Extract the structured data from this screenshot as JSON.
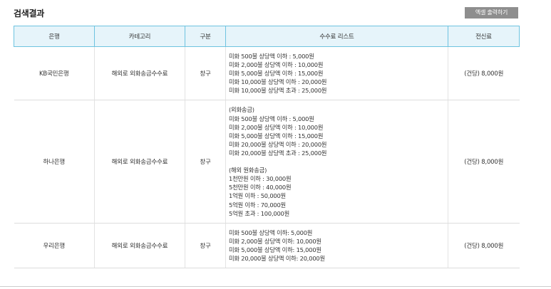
{
  "header": {
    "title": "검색결과",
    "export_label": "엑셀 출력하기"
  },
  "table": {
    "columns": [
      "은행",
      "카테고리",
      "구분",
      "수수료 리스트",
      "전신료"
    ],
    "rows": [
      {
        "bank": "KB국민은행",
        "category": "해외로 외화송금수수료",
        "type": "창구",
        "fees": [
          "미화 500불 상당액 이하 : 5,000원",
          "미화 2,000불 상당액 이하 : 10,000원",
          "미화 5,000불 상당액 이하 : 15,000원",
          "미화 10,000불 상당액 이하 : 20,000원",
          "미화 10,000불 상당액 초과 : 25,000원"
        ],
        "telegraph": "(건당) 8,000원"
      },
      {
        "bank": "하나은행",
        "category": "해외로 외화송금수수료",
        "type": "창구",
        "fees": [
          "(외화송금)",
          "미화 500불 상당액 이하 : 5,000원",
          "미화 2,000불 상당액 이하 : 10,000원",
          "미화 5,000불 상당액 이하 : 15,000원",
          "미화 20,000불 상당액 이하 : 20,000원",
          "미화 20,000불 상당액 초과 : 25,000원",
          "",
          "(해외 원화송금)",
          "1천만원 이하 : 30,000원",
          "5천만원 이하 : 40,000원",
          "1억원 이하 : 50,000원",
          "5억원 이하 : 70,000원",
          "5억원 초과 : 100,000원"
        ],
        "telegraph": "(건당) 8,000원"
      },
      {
        "bank": "우리은행",
        "category": "해외로 외화송금수수료",
        "type": "창구",
        "fees": [
          "미화 500불 상당액 이하: 5,000원",
          "미화 2,000불 상당액 이하: 10,000원",
          "미화 5,000불 상당액 이하: 15,000원",
          "미화 20,000불 상당액 이하: 20,000원"
        ],
        "telegraph": "(건당) 8,000원"
      }
    ]
  }
}
